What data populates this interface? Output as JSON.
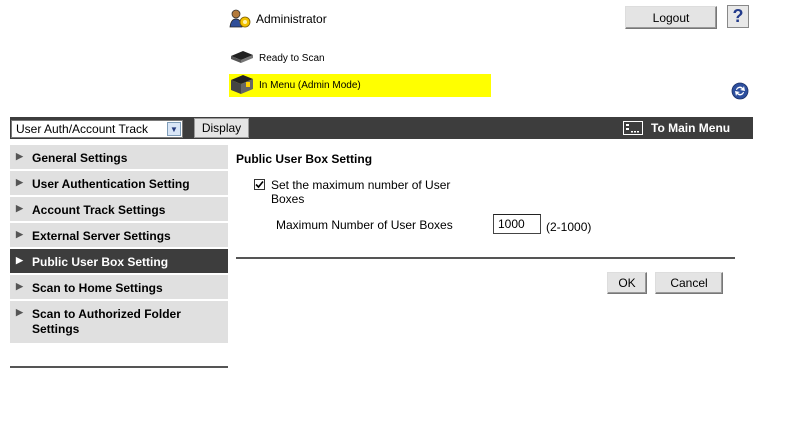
{
  "header": {
    "user_label": "Administrator",
    "logout_label": "Logout",
    "help_label": "?",
    "status": [
      {
        "text": "Ready to Scan",
        "icon": "scanner-ready-icon"
      },
      {
        "text": "In Menu (Admin Mode)",
        "icon": "scanner-menu-icon",
        "highlight": "#ffff00"
      }
    ]
  },
  "menubar": {
    "mode_select_value": "User Auth/Account Track",
    "display_label": "Display",
    "main_menu_label": "To Main Menu"
  },
  "sidebar": {
    "items": [
      {
        "label": "General Settings",
        "active": false
      },
      {
        "label": "User Authentication Setting",
        "active": false
      },
      {
        "label": "Account Track Settings",
        "active": false
      },
      {
        "label": "External Server Settings",
        "active": false
      },
      {
        "label": "Public User Box Setting",
        "active": true
      },
      {
        "label": "Scan to Home Settings",
        "active": false
      },
      {
        "label": "Scan to Authorized Folder Settings",
        "active": false
      }
    ]
  },
  "content": {
    "title": "Public User Box Setting",
    "checkbox_label": "Set the maximum number of User Boxes",
    "checkbox_checked": true,
    "max_label": "Maximum Number of User Boxes",
    "max_value": "1000",
    "range_label": "(2-1000)",
    "ok_label": "OK",
    "cancel_label": "Cancel"
  },
  "colors": {
    "menubar": "#3d3d3d",
    "status_highlight": "#ffff00",
    "sidebar_bg": "#e0e0e0"
  }
}
